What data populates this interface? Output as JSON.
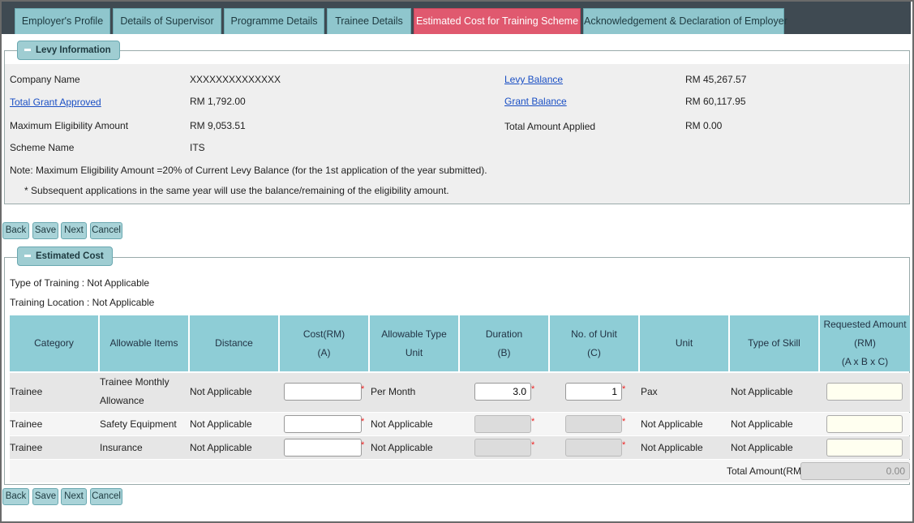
{
  "tabs": [
    {
      "label": "Employer's Profile"
    },
    {
      "label": "Details of Supervisor"
    },
    {
      "label": "Programme Details"
    },
    {
      "label": "Trainee Details"
    },
    {
      "label": "Estimated Cost for Training Scheme"
    },
    {
      "label": "Acknowledgement & Declaration of Employer"
    }
  ],
  "levy": {
    "legend": "Levy Information",
    "company_name_label": "Company Name",
    "company_name_value": "XXXXXXXXXXXXXX",
    "total_grant_label": "Total Grant Approved",
    "total_grant_value": "RM 1,792.00",
    "max_elig_label": "Maximum Eligibility Amount",
    "max_elig_value": "RM 9,053.51",
    "scheme_label": "Scheme Name",
    "scheme_value": "ITS",
    "levy_balance_label": "Levy Balance",
    "levy_balance_value": "RM 45,267.57",
    "grant_balance_label": "Grant Balance",
    "grant_balance_value": "RM 60,117.95",
    "total_applied_label": "Total Amount Applied",
    "total_applied_value": "RM 0.00",
    "note1": "Note: Maximum Eligibility Amount =20% of Current Levy Balance (for the 1st application of the year submitted).",
    "note2": "* Subsequent applications in the same year will use the balance/remaining of the eligibility amount."
  },
  "buttons": {
    "back": "Back",
    "save": "Save",
    "next": "Next",
    "cancel": "Cancel"
  },
  "estimated": {
    "legend": "Estimated Cost",
    "type_of_training": "Type of Training : Not Applicable",
    "training_location": "Training Location : Not Applicable",
    "headers": {
      "category": "Category",
      "allowable_items": "Allowable Items",
      "distance": "Distance",
      "cost_l1": "Cost(RM)",
      "cost_l2": "(A)",
      "type_unit_l1": "Allowable Type",
      "type_unit_l2": "Unit",
      "duration_l1": "Duration",
      "duration_l2": "(B)",
      "units_l1": "No. of Unit",
      "units_l2": "(C)",
      "unit": "Unit",
      "skill": "Type of Skill",
      "req_l1": "Requested Amount",
      "req_l2": "(RM)",
      "req_l3": "(A x B x C)"
    },
    "rows": [
      {
        "category": "Trainee",
        "item_l1": "Trainee Monthly",
        "item_l2": "Allowance",
        "distance": "Not Applicable",
        "type_unit": "Per Month",
        "duration": "3.0",
        "units": "1",
        "unit": "Pax",
        "skill": "Not Applicable"
      },
      {
        "category": "Trainee",
        "item_l1": "Safety Equipment",
        "item_l2": "",
        "distance": "Not Applicable",
        "type_unit": "Not Applicable",
        "duration": "",
        "units": "",
        "unit": "Not Applicable",
        "skill": "Not Applicable"
      },
      {
        "category": "Trainee",
        "item_l1": "Insurance",
        "item_l2": "",
        "distance": "Not Applicable",
        "type_unit": "Not Applicable",
        "duration": "",
        "units": "",
        "unit": "Not Applicable",
        "skill": "Not Applicable"
      }
    ],
    "total_label": "Total Amount(RM):",
    "total_value": "0.00"
  },
  "colors": {
    "active_tab": "#e0596f",
    "tab": "#8fc6cd",
    "header": "#8ecdd6",
    "link": "#1a4fc4"
  }
}
